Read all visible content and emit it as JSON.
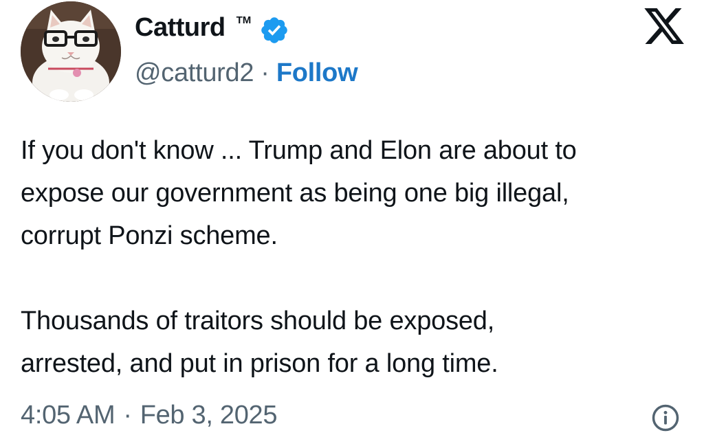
{
  "author": {
    "display_name": "Catturd",
    "trademark": "TM",
    "handle": "@catturd2",
    "separator": "·",
    "follow_label": "Follow",
    "verified": true,
    "avatar_icon": "cat-with-glasses-avatar"
  },
  "platform": {
    "logo_icon": "x-logo-icon"
  },
  "tweet": {
    "paragraphs": [
      "If you don't know  ... Trump and Elon are about to\nexpose our government as being one big illegal,\ncorrupt Ponzi scheme.",
      "Thousands of traitors should be exposed,\narrested, and put in prison for a long time."
    ],
    "time": "4:05 AM",
    "separator": "·",
    "date": "Feb 3, 2025"
  },
  "colors": {
    "follow": "#1d78c8",
    "verified_badge": "#1d9bf0",
    "secondary_text": "#536471",
    "primary_text": "#0f1419"
  },
  "icons": {
    "verified": "verified-badge-icon",
    "info": "info-icon"
  }
}
